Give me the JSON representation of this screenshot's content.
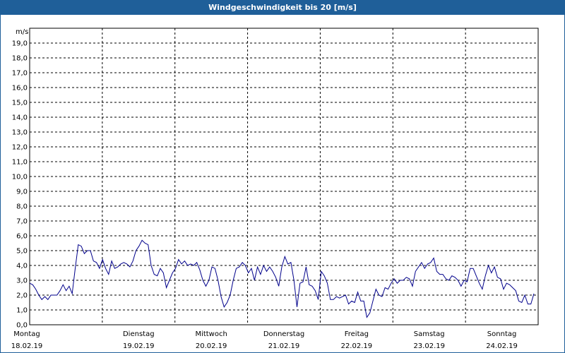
{
  "window": {
    "title": "Windgeschwindigkeit bis 20 [m/s]"
  },
  "chart_data": {
    "type": "line",
    "title": "Windgeschwindigkeit bis 20 [m/s]",
    "ylabel": "m/s",
    "xlabel": "",
    "ylim": [
      0,
      20
    ],
    "grid": true,
    "line_color": "#00008b",
    "yticks": [
      "0,0",
      "1,0",
      "2,0",
      "3,0",
      "4,0",
      "5,0",
      "6,0",
      "7,0",
      "8,0",
      "9,0",
      "10,0",
      "11,0",
      "12,0",
      "13,0",
      "14,0",
      "15,0",
      "16,0",
      "17,0",
      "18,0",
      "19,0"
    ],
    "days": [
      {
        "day": "Montag",
        "date": "18.02.19"
      },
      {
        "day": "Dienstag",
        "date": "19.02.19"
      },
      {
        "day": "Mittwoch",
        "date": "20.02.19"
      },
      {
        "day": "Donnerstag",
        "date": "21.02.19"
      },
      {
        "day": "Freitag",
        "date": "22.02.19"
      },
      {
        "day": "Samstag",
        "date": "23.02.19"
      },
      {
        "day": "Sonntag",
        "date": "24.02.19"
      }
    ],
    "series": [
      {
        "values": [
          2.8,
          2.7,
          2.4,
          2.0,
          1.7,
          1.9,
          1.7,
          2.0,
          2.0,
          2.0,
          2.3,
          2.7,
          2.3,
          2.6,
          2.1,
          3.8,
          5.4,
          5.3,
          4.8,
          5.0,
          5.0,
          4.3,
          4.2,
          3.8,
          4.4,
          3.8,
          3.4,
          4.3,
          3.8,
          3.9,
          4.1,
          4.2,
          4.1,
          3.9,
          4.3,
          5.0,
          5.3,
          5.7,
          5.5,
          5.4,
          4.0,
          3.4,
          3.3,
          3.8,
          3.5,
          2.5,
          3.0,
          3.5,
          3.8,
          4.4,
          4.1,
          4.3,
          4.0,
          4.1,
          4.0,
          4.2,
          3.7,
          3.0,
          2.6,
          3.0,
          3.9,
          3.8,
          3.0,
          1.9,
          1.2,
          1.5,
          2.0,
          3.0,
          3.8,
          3.9,
          4.2,
          4.0,
          3.5,
          3.8,
          3.0,
          3.9,
          3.4,
          4.0,
          3.6,
          3.9,
          3.6,
          3.2,
          2.6,
          3.9,
          4.6,
          4.1,
          4.2,
          3.0,
          1.2,
          2.8,
          2.9,
          3.9,
          2.7,
          2.6,
          2.3,
          1.7,
          3.6,
          3.3,
          2.8,
          1.7,
          1.7,
          1.9,
          1.8,
          1.9,
          2.0,
          1.4,
          1.6,
          1.5,
          2.2,
          1.6,
          1.6,
          0.5,
          0.8,
          1.6,
          2.4,
          2.0,
          1.9,
          2.5,
          2.4,
          2.8,
          3.1,
          2.8,
          3.0,
          3.0,
          3.2,
          3.1,
          2.6,
          3.6,
          3.9,
          4.2,
          3.8,
          4.1,
          4.2,
          4.5,
          3.6,
          3.4,
          3.4,
          3.1,
          3.0,
          3.3,
          3.2,
          3.0,
          2.6,
          3.0,
          2.9,
          3.8,
          3.8,
          3.3,
          2.8,
          2.4,
          3.3,
          4.0,
          3.5,
          3.9,
          3.2,
          3.1,
          2.4,
          2.8,
          2.7,
          2.5,
          2.3,
          1.6,
          1.5,
          2.0,
          1.4,
          1.4,
          2.1
        ]
      }
    ]
  }
}
